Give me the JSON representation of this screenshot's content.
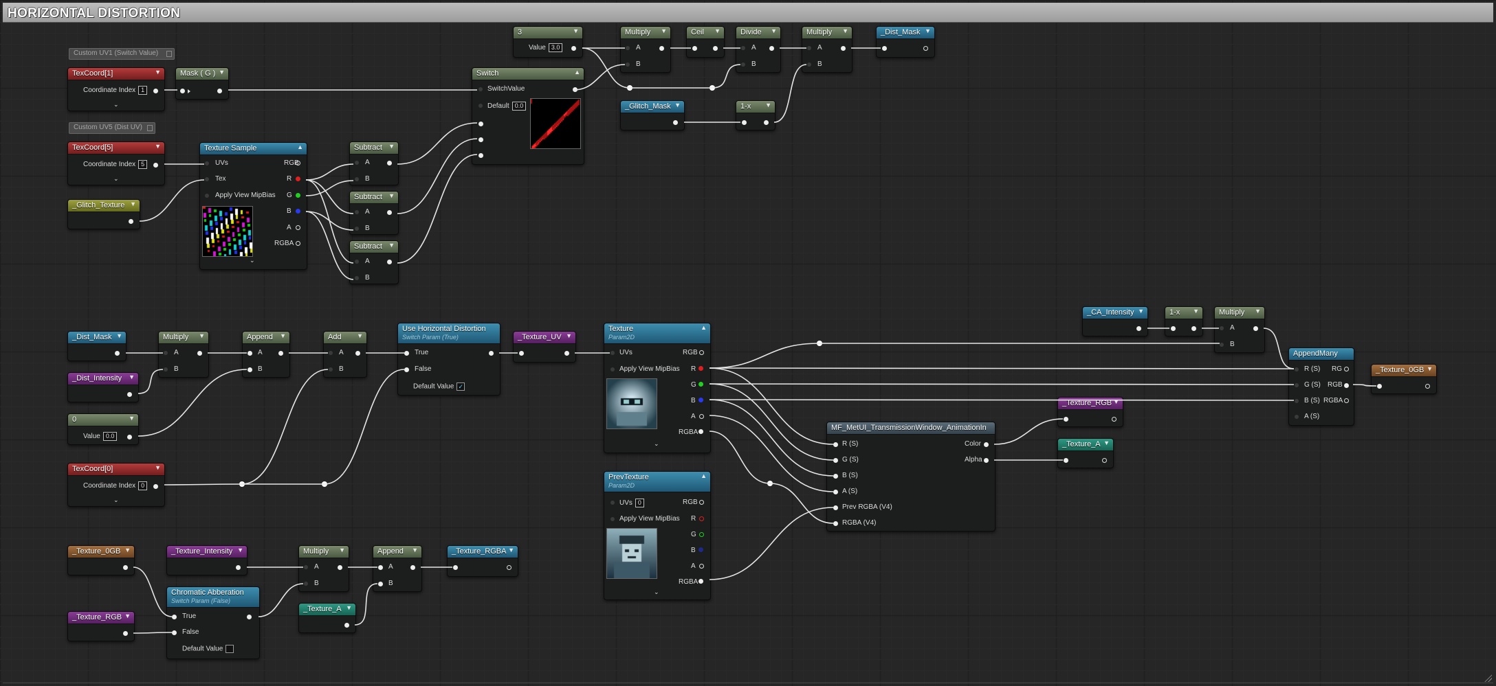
{
  "window": {
    "title": "HORIZONTAL DISTORTION"
  },
  "comments": {
    "uv1": "Custom UV1 (Switch Value)",
    "uv5": "Custom UV5 (Dist UV)"
  },
  "labels": {
    "A": "A",
    "B": "B",
    "True": "True",
    "False": "False",
    "UVs": "UVs",
    "Tex": "Tex",
    "RGB": "RGB",
    "R": "R",
    "G": "G",
    "B2": "B",
    "Alpha_A": "A",
    "RGBA": "RGBA",
    "ApplyMip": "Apply View MipBias",
    "CoordIndex": "Coordinate Index",
    "Value": "Value",
    "SwitchValue": "SwitchValue",
    "Default": "Default",
    "DefaultValue": "Default Value",
    "RS": "R (S)",
    "GS": "G (S)",
    "BS": "B (S)",
    "AS": "A (S)",
    "RG": "RG",
    "PrevRGBA": "Prev RGBA (V4)",
    "RGBAV4": "RGBA (V4)",
    "Color": "Color",
    "Alpha": "Alpha"
  },
  "nodes": {
    "texcoord1": {
      "title": "TexCoord[1]",
      "index": "1"
    },
    "maskg": {
      "title": "Mask ( G )"
    },
    "texcoord5": {
      "title": "TexCoord[5]",
      "index": "5"
    },
    "glitchtex": {
      "title": "_Glitch_Texture"
    },
    "texsample": {
      "title": "Texture Sample"
    },
    "sub1": {
      "title": "Subtract"
    },
    "sub2": {
      "title": "Subtract"
    },
    "sub3": {
      "title": "Subtract"
    },
    "switch": {
      "title": "Switch",
      "default": "0.0"
    },
    "const3": {
      "title": "3",
      "value": "3.0"
    },
    "mult1": {
      "title": "Multiply"
    },
    "ceil": {
      "title": "Ceil"
    },
    "divide": {
      "title": "Divide"
    },
    "mult2": {
      "title": "Multiply"
    },
    "distmask_out": {
      "title": "_Dist_Mask"
    },
    "glitchmask": {
      "title": "_Glitch_Mask"
    },
    "oneminus1": {
      "title": "1-x"
    },
    "distmask_in": {
      "title": "_Dist_Mask"
    },
    "mult3": {
      "title": "Multiply"
    },
    "append1": {
      "title": "Append"
    },
    "add": {
      "title": "Add"
    },
    "usehd": {
      "title": "Use Horizontal Distortion",
      "subtitle": "Switch Param (True)"
    },
    "textureuv": {
      "title": "_Texture_UV"
    },
    "distintensity": {
      "title": "_Dist_Intensity"
    },
    "const0": {
      "title": "0",
      "value": "0.0"
    },
    "texcoord0": {
      "title": "TexCoord[0]",
      "index": "0"
    },
    "texture": {
      "title": "Texture",
      "subtitle": "Param2D"
    },
    "prevtexture": {
      "title": "PrevTexture",
      "subtitle": "Param2D",
      "uvs": "0"
    },
    "mf": {
      "title": "MF_MetUI_TransmissionWindow_AnimationIn"
    },
    "caintensity": {
      "title": "_CA_Intensity"
    },
    "oneminus2": {
      "title": "1-x"
    },
    "mult4": {
      "title": "Multiply"
    },
    "appendmany": {
      "title": "AppendMany"
    },
    "texture0gb_out": {
      "title": "_Texture_0GB"
    },
    "texturergb_out": {
      "title": "_Texture_RGB"
    },
    "texturea_out": {
      "title": "_Texture_A"
    },
    "texture0gb_in": {
      "title": "_Texture_0GB"
    },
    "textureintensity": {
      "title": "_Texture_Intensity"
    },
    "mult5": {
      "title": "Multiply"
    },
    "append2": {
      "title": "Append"
    },
    "texturergba": {
      "title": "_Texture_RGBA"
    },
    "chromatic": {
      "title": "Chromatic Abberation",
      "subtitle": "Switch Param (False)"
    },
    "texturergb_in": {
      "title": "_Texture_RGB"
    },
    "texturea_in": {
      "title": "_Texture_A"
    }
  },
  "colors": {
    "wire": "#e6e6e6",
    "background": "#262626",
    "grid": "#303030"
  }
}
